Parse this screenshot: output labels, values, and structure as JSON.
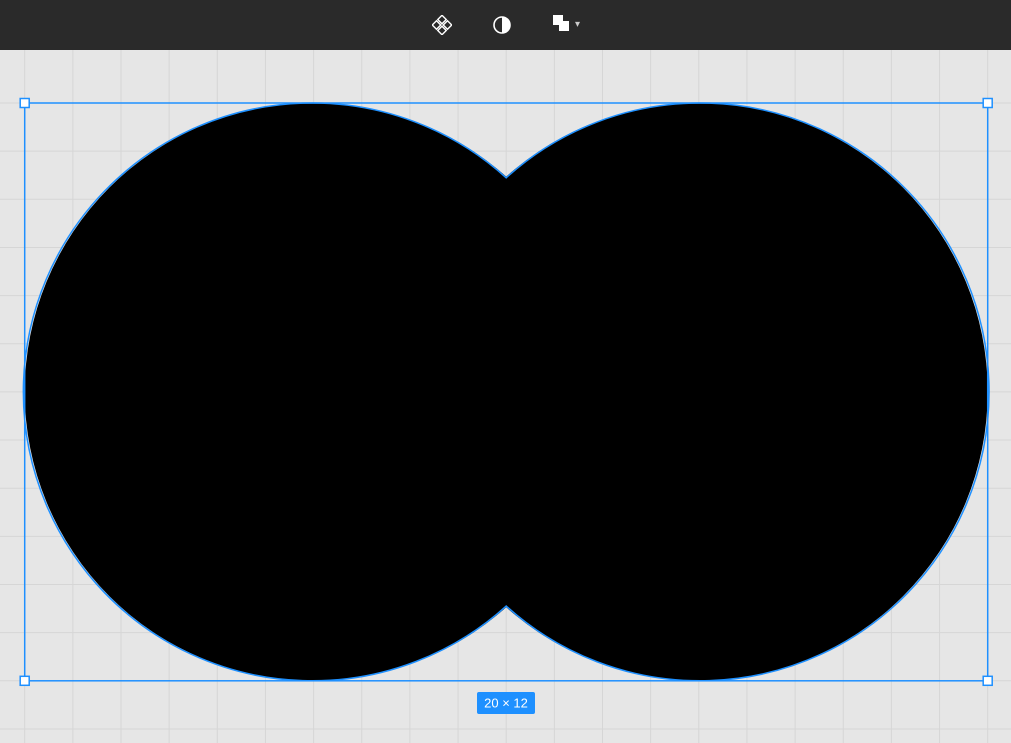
{
  "toolbar": {
    "components_label": "Components",
    "mask_label": "Mask",
    "boolean_label": "Boolean groups"
  },
  "selection": {
    "dimensions_label": "20 × 12",
    "width_units": 20,
    "height_units": 12
  },
  "colors": {
    "selection": "#1e90ff",
    "shape_fill": "#000000",
    "canvas_bg": "#e6e6e6",
    "grid": "#d6d6d6",
    "toolbar_bg": "#2a2a2a"
  }
}
